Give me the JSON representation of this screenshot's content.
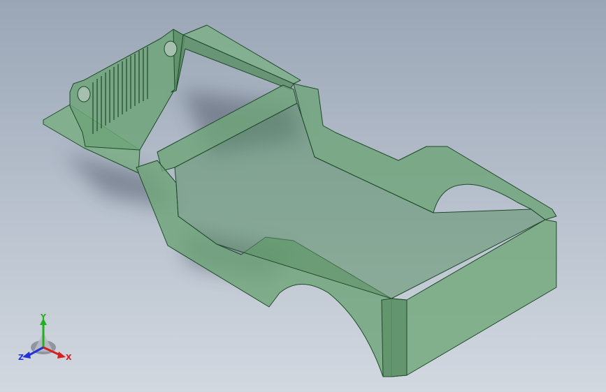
{
  "viewport": {
    "background_top": "#9aa6b6",
    "background_bottom": "#d2d8e0",
    "model_fill": "#6fa57a",
    "model_edge": "#1f4a2a"
  },
  "triad": {
    "x_label": "X",
    "y_label": "Y",
    "z_label": "Z",
    "x_color": "#d62020",
    "y_color": "#22b022",
    "z_color": "#2233d6"
  }
}
